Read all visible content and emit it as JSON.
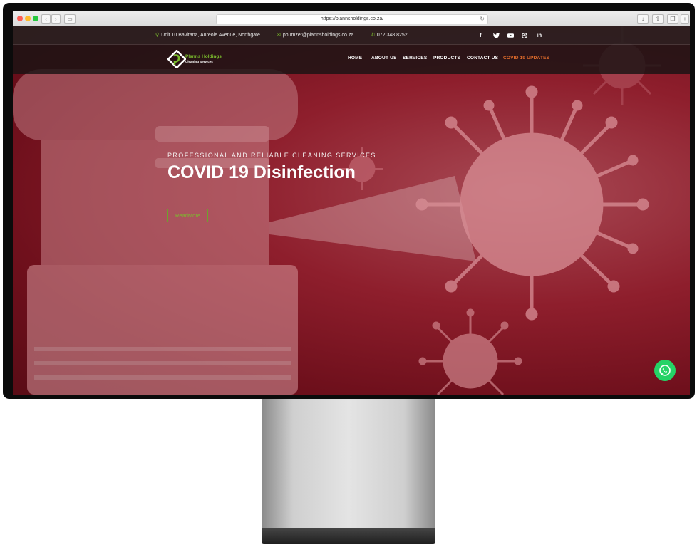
{
  "browser": {
    "url": "https://plannsholdings.co.za/"
  },
  "topbar": {
    "address": "Unit 10 Bavitana, Aureole Avenue, Northgate",
    "email": "phumzet@plannsholdings.co.za",
    "phone": "072 348 8252",
    "social": [
      {
        "label": "f",
        "icon": "facebook-icon"
      },
      {
        "label": "twitter",
        "icon": "twitter-icon"
      },
      {
        "label": "youtube",
        "icon": "youtube-icon"
      },
      {
        "label": "dribbble",
        "icon": "dribbble-icon"
      },
      {
        "label": "in",
        "icon": "linkedin-icon"
      }
    ]
  },
  "logo": {
    "name": "Planns Holdings",
    "tagline": "Cleaning Services"
  },
  "nav": {
    "home": "HOME",
    "about": "ABOUT US",
    "services": "SERVICES",
    "products": "PRODUCTS",
    "contact": "CONTACT US",
    "covid": "COVID 19 UPDATES"
  },
  "hero": {
    "eyebrow": "PROFESSIONAL AND RELIABLE CLEANING SERVICES",
    "headline": "COVID 19 Disinfection",
    "button": "ReadMore"
  },
  "colors": {
    "accent_green": "#7bbd2d",
    "active_nav": "#e06c2c",
    "whatsapp": "#25d366",
    "hero_red": "#8e1e2c"
  }
}
